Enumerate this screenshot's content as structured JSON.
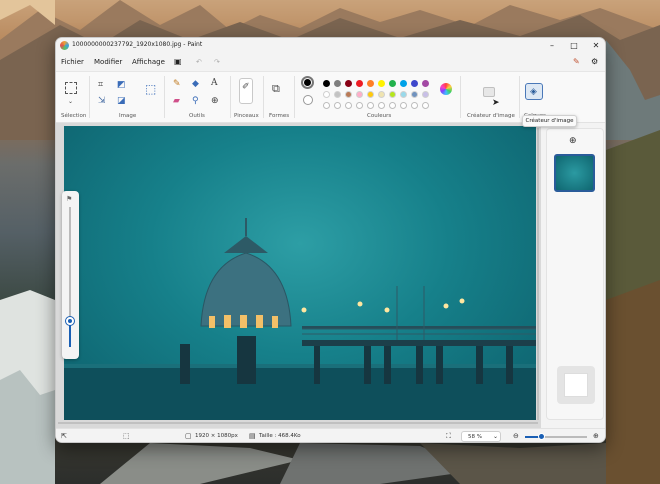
{
  "window": {
    "title": "1000000000237792_1920x1080.jpg - Paint"
  },
  "menu": {
    "file": "Fichier",
    "edit": "Modifier",
    "view": "Affichage"
  },
  "ribbon": {
    "groups": {
      "selection": "Sélection",
      "image": "Image",
      "tools": "Outils",
      "brushes": "Pinceaux",
      "shapes": "Formes",
      "colors": "Couleurs",
      "image_creator": "Créateur d'image",
      "layers": "Calques"
    },
    "tools_text_glyph": "A",
    "primary_color": "#000000",
    "secondary_color": "#ffffff",
    "swatches_row1": [
      "#000000",
      "#7f7f7f",
      "#880015",
      "#ed1c24",
      "#ff7f27",
      "#fff200",
      "#22b14c",
      "#00a2e8",
      "#3f48cc",
      "#a349a4"
    ],
    "swatches_row2": [
      "#ffffff",
      "#c3c3c3",
      "#b97a57",
      "#ffaec9",
      "#ffc90e",
      "#efe4b0",
      "#b5e61d",
      "#99d9ea",
      "#7092be",
      "#c8bfe7"
    ]
  },
  "tooltip": "Créateur d'image",
  "status": {
    "dimensions": "1920 × 1080px",
    "size": "Taille : 468.4Ko",
    "zoom": "58 %"
  },
  "zoom_level": 0.26
}
